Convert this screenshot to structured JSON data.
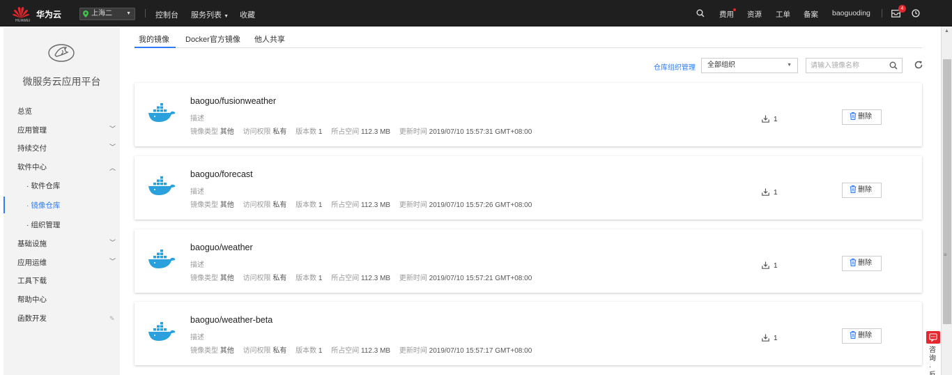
{
  "topbar": {
    "logo_text": "HUAWEI",
    "brand": "华为云",
    "region": "上海二",
    "nav": [
      "控制台",
      "服务列表",
      "收藏"
    ],
    "right_items": [
      "费用",
      "资源",
      "工单",
      "备案"
    ],
    "user": "baoguoding",
    "message_count": "4",
    "colors": {
      "background": "#1f1f1f",
      "badge": "#e5262d",
      "region_pin": "#41c24b"
    }
  },
  "sidebar": {
    "title": "微服务云应用平台",
    "items": [
      {
        "label": "总览"
      },
      {
        "label": "应用管理"
      },
      {
        "label": "持续交付"
      },
      {
        "label": "软件中心"
      },
      {
        "label": "软件仓库"
      },
      {
        "label": "镜像仓库"
      },
      {
        "label": "组织管理"
      },
      {
        "label": "基础设施"
      },
      {
        "label": "应用运维"
      },
      {
        "label": "工具下载"
      },
      {
        "label": "帮助中心"
      },
      {
        "label": "函数开发"
      }
    ],
    "active_item": "镜像仓库",
    "accent_color": "#2f7cf6"
  },
  "tabs": [
    "我的镜像",
    "Docker官方镜像",
    "他人共享"
  ],
  "toolbar": {
    "org_link": "仓库组织管理",
    "org_select": "全部组织",
    "search_placeholder": "请输入镜像名称"
  },
  "meta_labels": {
    "type": "镜像类型",
    "access": "访问权限",
    "versions": "版本数",
    "space": "所占空间",
    "updated": "更新时间"
  },
  "images": [
    {
      "name": "baoguo/fusionweather",
      "desc": "描述",
      "type": "其他",
      "access": "私有",
      "versions": "1",
      "space": "112.3 MB",
      "updated": "2019/07/10 15:57:31 GMT+08:00",
      "downloads": "1",
      "delete_label": "删除"
    },
    {
      "name": "baoguo/forecast",
      "desc": "描述",
      "type": "其他",
      "access": "私有",
      "versions": "1",
      "space": "112.3 MB",
      "updated": "2019/07/10 15:57:26 GMT+08:00",
      "downloads": "1",
      "delete_label": "删除"
    },
    {
      "name": "baoguo/weather",
      "desc": "描述",
      "type": "其他",
      "access": "私有",
      "versions": "1",
      "space": "112.3 MB",
      "updated": "2019/07/10 15:57:21 GMT+08:00",
      "downloads": "1",
      "delete_label": "删除"
    },
    {
      "name": "baoguo/weather-beta",
      "desc": "描述",
      "type": "其他",
      "access": "私有",
      "versions": "1",
      "space": "112.3 MB",
      "updated": "2019/07/10 15:57:17 GMT+08:00",
      "downloads": "1",
      "delete_label": "删除"
    }
  ],
  "float": {
    "consult": "咨询·反"
  },
  "icons": {
    "docker": "docker-whale-icon",
    "download": "download-icon",
    "delete": "trash-icon",
    "search": "search-icon",
    "refresh": "refresh-icon",
    "messages": "mail-icon",
    "clock": "clock-icon"
  }
}
